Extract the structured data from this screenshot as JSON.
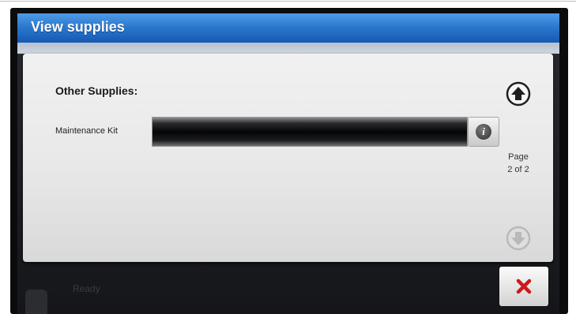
{
  "header": {
    "title": "View supplies"
  },
  "content": {
    "section_heading": "Other Supplies:",
    "items": [
      {
        "label": "Maintenance Kit",
        "info_icon": "info-icon"
      }
    ],
    "page_indicator": {
      "line1": "Page",
      "line2": "2 of 2"
    },
    "navigation": {
      "up_icon": "arrow-up-circle-icon",
      "down_icon": "arrow-down-circle-icon"
    }
  },
  "status_bar": {
    "status_text": "Ready"
  },
  "actions": {
    "close_icon": "close-x-icon"
  },
  "colors": {
    "title_bar": "#2d79cf",
    "close_x": "#cc1a1a",
    "supply_bar": "#050505"
  }
}
